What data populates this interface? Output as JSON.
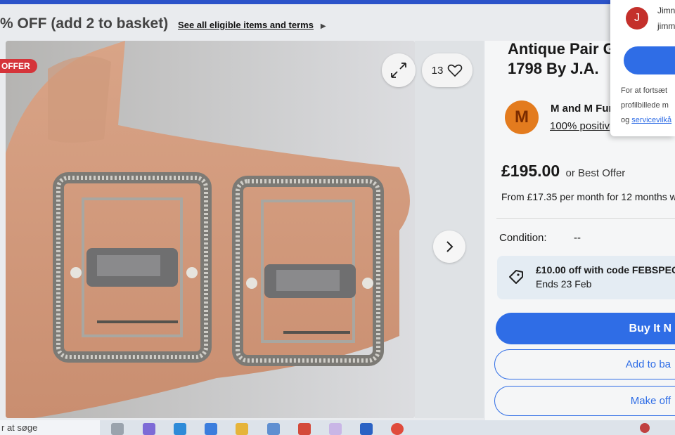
{
  "promo": {
    "text": "% OFF (add 2 to basket)",
    "link": "See all eligible items and terms"
  },
  "gallery": {
    "badge": "OFFER",
    "watch_count": "13"
  },
  "listing": {
    "title_line1": "Antique Pair G",
    "title_line2": "1798 By J.A."
  },
  "seller": {
    "initial": "M",
    "name": "M and M Fur",
    "feedback": "100% positiv"
  },
  "price": {
    "amount": "£195.00",
    "best_offer": "or Best Offer",
    "finance": "From £17.35 per month for 12 months w"
  },
  "condition": {
    "label": "Condition:",
    "value": "--"
  },
  "coupon": {
    "code_text": "£10.00 off with code FEBSPEC",
    "ends": "Ends 23 Feb"
  },
  "buttons": {
    "buy": "Buy It N",
    "add": "Add to ba",
    "offer": "Make off"
  },
  "account_popup": {
    "initial": "J",
    "name": "Jimn",
    "email": "jimm",
    "line1": "For at fortsæt",
    "line2": "profilbillede m",
    "line3_prefix": "og ",
    "line3_link": "servicevilkå"
  },
  "taskbar": {
    "search": "r at søge"
  },
  "colors": {
    "ebay_blue": "#2f6de6",
    "offer_red": "#d5343a",
    "seller_orange": "#e37b1e",
    "avatar_red": "#c4302b"
  }
}
